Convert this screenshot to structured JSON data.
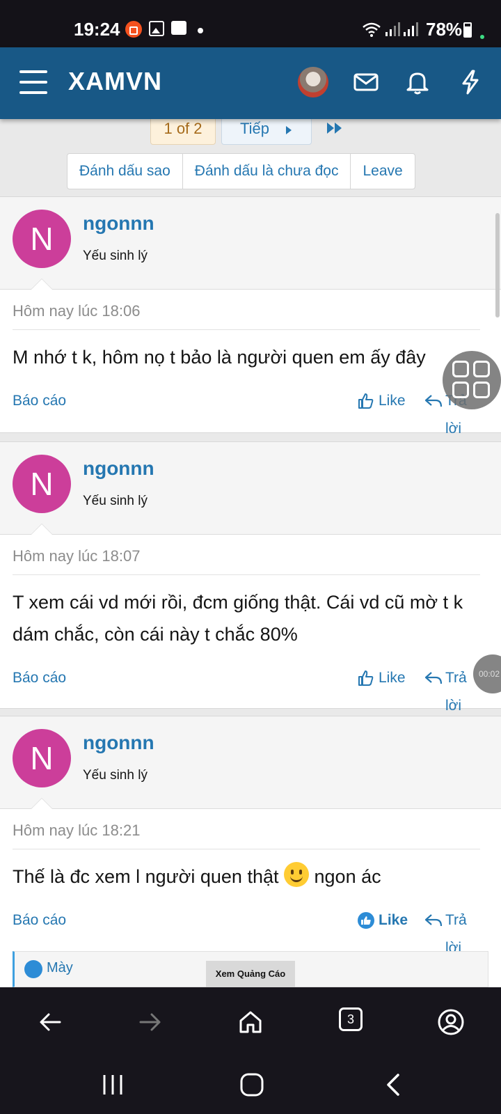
{
  "status_bar": {
    "time": "19:24",
    "battery": "78%"
  },
  "app_bar": {
    "brand": "XAMVN"
  },
  "pagination": {
    "current": "1 of 2",
    "next": "Tiếp"
  },
  "thread_actions": [
    "Đánh dấu sao",
    "Đánh dấu là chưa đọc",
    "Leave"
  ],
  "posts": [
    {
      "avatar_letter": "N",
      "username": "ngonnn",
      "user_title": "Yếu sinh lý",
      "date": "Hôm nay lúc 18:06",
      "message": "M nhớ t k, hôm nọ t bảo là người quen em ấy đây",
      "report": "Báo cáo",
      "like": "Like",
      "reply": "Trả lời"
    },
    {
      "avatar_letter": "N",
      "username": "ngonnn",
      "user_title": "Yếu sinh lý",
      "date": "Hôm nay lúc 18:07",
      "message": "T xem cái vd mới rồi, đcm giống thật. Cái vd cũ mờ t k dám chắc, còn cái này t chắc 80%",
      "report": "Báo cáo",
      "like": "Like",
      "reply": "Trả lời"
    },
    {
      "avatar_letter": "N",
      "username": "ngonnn",
      "user_title": "Yếu sinh lý",
      "date": "Hôm nay lúc 18:21",
      "message_before": "Thế là đc xem l người quen thật",
      "message_after": "ngon ác",
      "report": "Báo cáo",
      "like": "Like",
      "reply": "Trả lời"
    }
  ],
  "reactions": {
    "names": "Mày"
  },
  "ad_label": "Xem Quảng Cáo",
  "recording_timer": "00:02",
  "browser": {
    "tab_count": "3"
  },
  "colors": {
    "header": "#185886",
    "link": "#2577b1",
    "avatar": "#cc3e9a"
  },
  "icons": [
    "menu-icon",
    "mail-icon",
    "bell-icon",
    "lightning-icon",
    "like-icon",
    "reply-icon",
    "back-icon",
    "forward-icon",
    "home-icon",
    "tabs-icon",
    "account-icon"
  ]
}
